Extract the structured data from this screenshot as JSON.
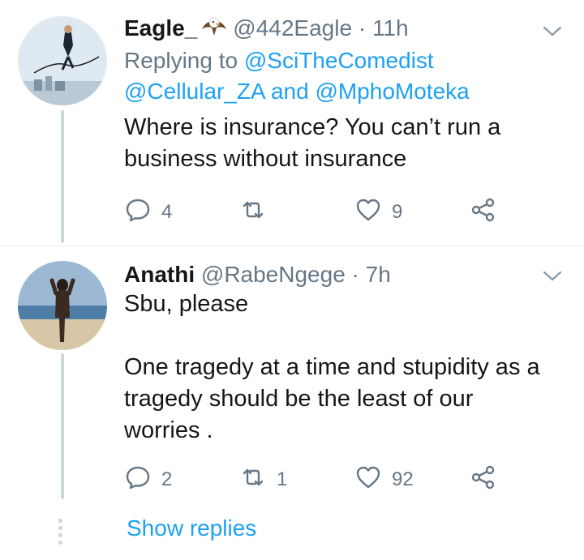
{
  "tweets": [
    {
      "name": "Eagle_",
      "handle": "@442Eagle",
      "dot": "·",
      "time": "11h",
      "replying_prefix": "Replying to",
      "replying_to_1": "@SciTheComedist",
      "replying_to_2": "@Cellular_ZA",
      "replying_and": "and",
      "replying_to_3": "@MphoMoteka",
      "text_line1": "Where is insurance? You can’t run a",
      "text_line2": "business without insurance",
      "replies": "4",
      "retweets": "",
      "likes": "9"
    },
    {
      "name": "Anathi",
      "handle": "@RabeNgege",
      "dot": "·",
      "time": "7h",
      "text_line1": "Sbu, please",
      "text_line2": "One tragedy at a time and stupidity as a",
      "text_line3": "tragedy should be the least of our",
      "text_line4": "worries .",
      "replies": "2",
      "retweets": "1",
      "likes": "92"
    }
  ],
  "show_replies": "Show replies",
  "colors": {
    "accent": "#1da1f2",
    "secondary_text": "#657786",
    "primary_text": "#14171a",
    "thread_line": "#ccd6dd"
  },
  "icons": [
    "eagle-emoji-icon",
    "chevron-down-icon",
    "reply-icon",
    "retweet-icon",
    "like-icon",
    "share-icon"
  ]
}
